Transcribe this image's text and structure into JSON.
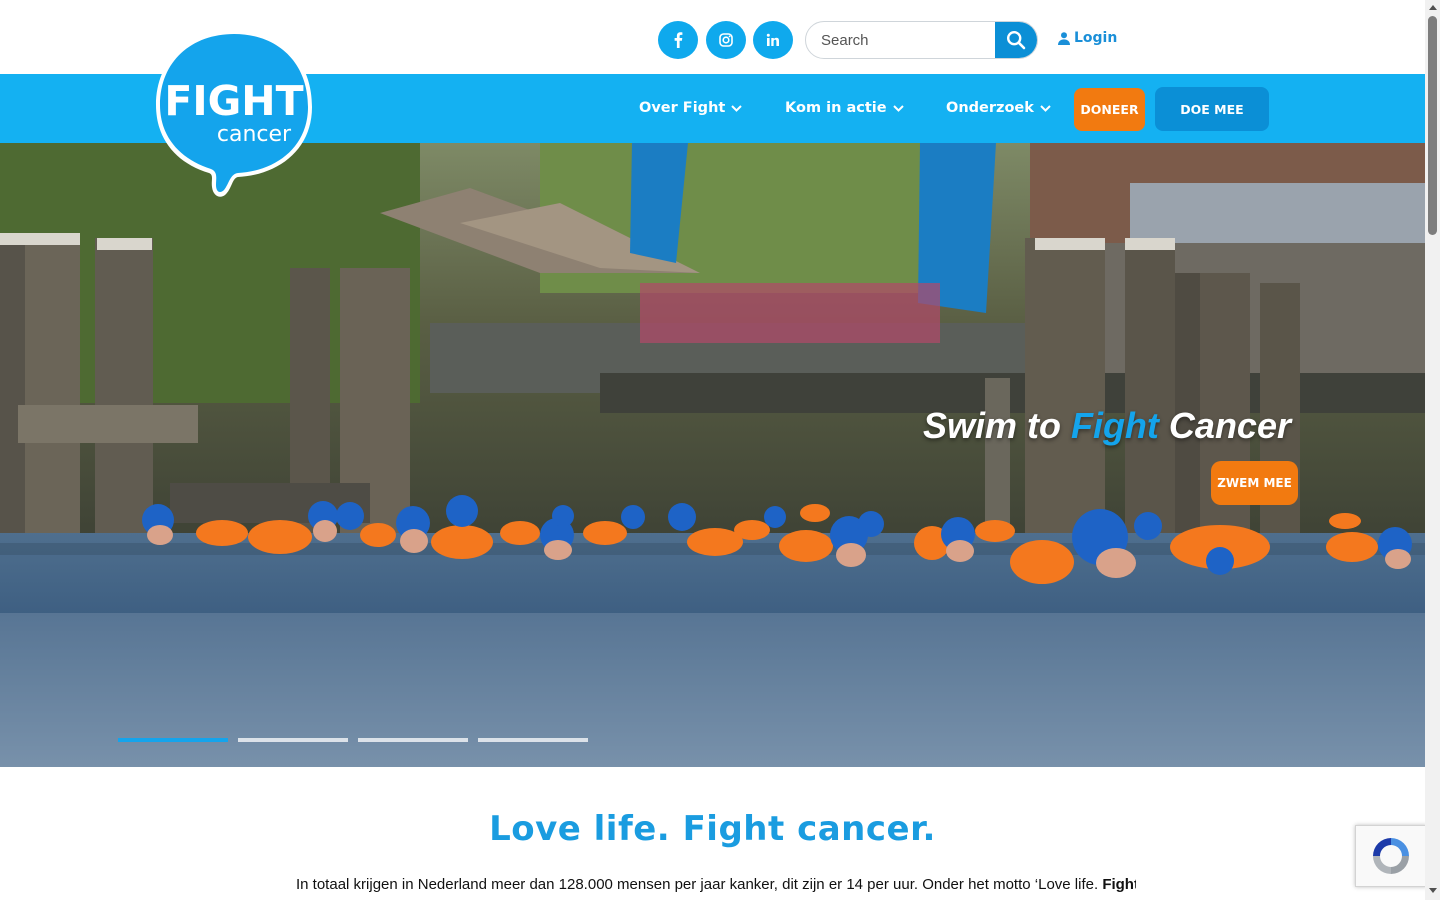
{
  "header": {
    "social": [
      {
        "name": "facebook-icon",
        "glyph": "f"
      },
      {
        "name": "instagram-icon",
        "glyph": "instagram"
      },
      {
        "name": "linkedin-icon",
        "glyph": "in"
      }
    ],
    "search": {
      "placeholder": "Search",
      "value": ""
    },
    "login_label": "Login"
  },
  "logo": {
    "line1": "FIGHT",
    "line2": "cancer"
  },
  "nav": {
    "items": [
      {
        "label": "Over Fight"
      },
      {
        "label": "Kom in actie"
      },
      {
        "label": "Onderzoek"
      }
    ],
    "doneer_label": "DONEER",
    "doemee_label": "DOE MEE"
  },
  "hero": {
    "title_part1": "Swim to ",
    "title_accent": "Fight",
    "title_part2": " Cancer",
    "cta_label": "ZWEM MEE",
    "slides_total": 4,
    "active_slide": 1
  },
  "content": {
    "tagline_light": "Love life. ",
    "tagline_bold": "Fight cancer.",
    "intro_text": "In totaal krijgen in Nederland meer dan 128.000 mensen per jaar kanker, dit zijn er 14 per uur. Onder het motto ‘Love life. ",
    "intro_bold": "Fight"
  },
  "colors": {
    "brand_blue": "#14b1f2",
    "dark_blue": "#0b8fd6",
    "orange": "#f27a10"
  }
}
